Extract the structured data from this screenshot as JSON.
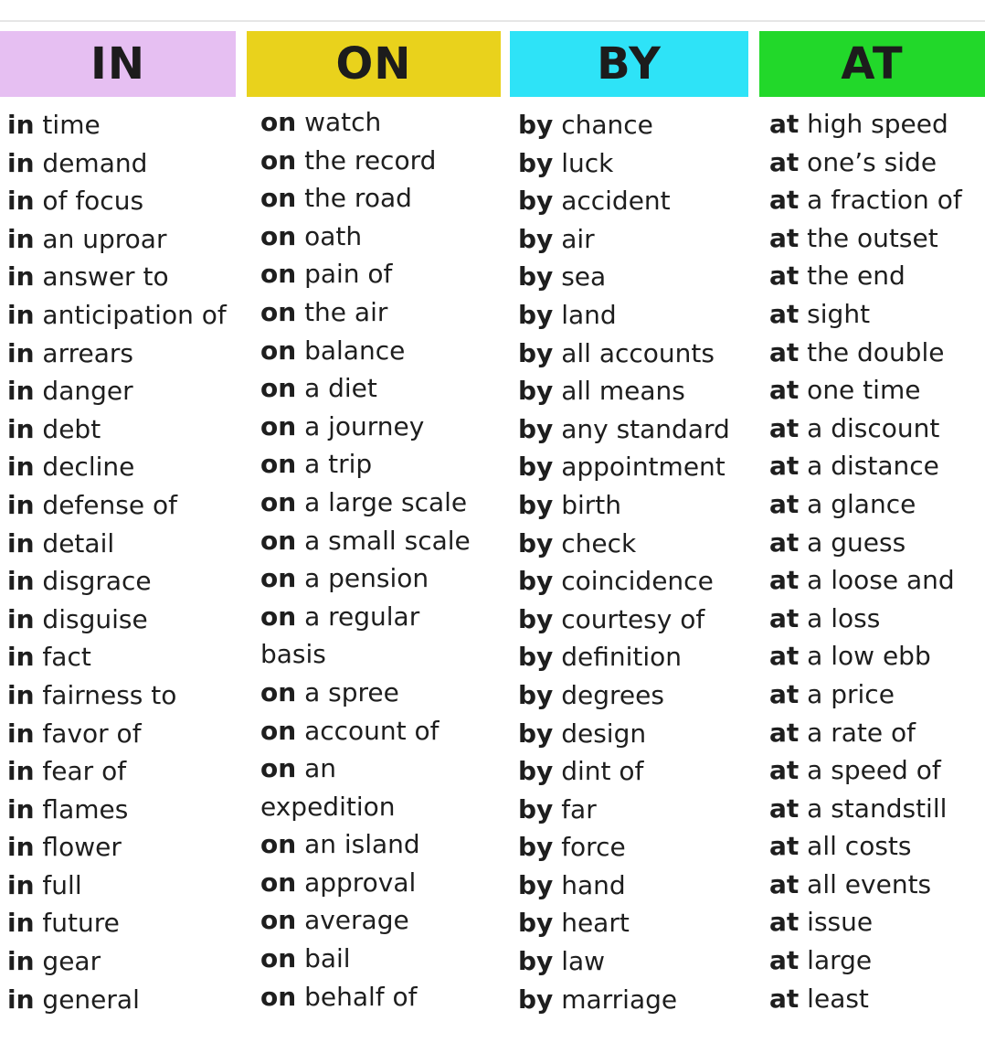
{
  "columns": [
    {
      "header": "IN",
      "color": "#e6bff2",
      "prefix": "in",
      "items": [
        "time",
        "demand",
        "of focus",
        "an uproar",
        "answer to",
        "anticipation of",
        "arrears",
        "danger",
        "debt",
        "decline",
        "defense of",
        "detail",
        "disgrace",
        "disguise",
        "fact",
        "fairness to",
        "favor of",
        "fear of",
        "flames",
        "flower",
        "full",
        "future",
        "gear",
        "general"
      ]
    },
    {
      "header": "ON",
      "color": "#e9d21c",
      "prefix": "on",
      "items": [
        "watch",
        "the record",
        "the road",
        "oath",
        "pain of",
        "the air",
        "balance",
        "a diet",
        "a journey",
        "a trip",
        "a large scale",
        "a small scale",
        "a pension",
        "a regular",
        "",
        "a spree",
        "account of",
        "an",
        "",
        "an island",
        "approval",
        "average",
        "bail",
        "behalf of"
      ],
      "plain_lines": {
        "14": "basis",
        "18": "expedition"
      }
    },
    {
      "header": "BY",
      "color": "#2ee3f7",
      "prefix": "by",
      "items": [
        "chance",
        "luck",
        "accident",
        "air",
        "sea",
        "land",
        "all accounts",
        "all means",
        "any standard",
        "appointment",
        "birth",
        "check",
        "coincidence",
        "courtesy of",
        "definition",
        "degrees",
        "design",
        "dint of",
        "far",
        "force",
        "hand",
        "heart",
        "law",
        "marriage"
      ]
    },
    {
      "header": "AT",
      "color": "#22d82a",
      "prefix": "at",
      "items": [
        "high speed",
        "one’s side",
        "a fraction of",
        "the outset",
        "the end",
        "sight",
        "the double",
        "one time",
        "a discount",
        "a distance",
        "a glance",
        "a guess",
        "a loose and",
        "a loss",
        "a low ebb",
        "a price",
        "a rate of",
        "a speed of",
        "a standstill",
        "all costs",
        "all events",
        "issue",
        "large",
        "least"
      ]
    }
  ]
}
